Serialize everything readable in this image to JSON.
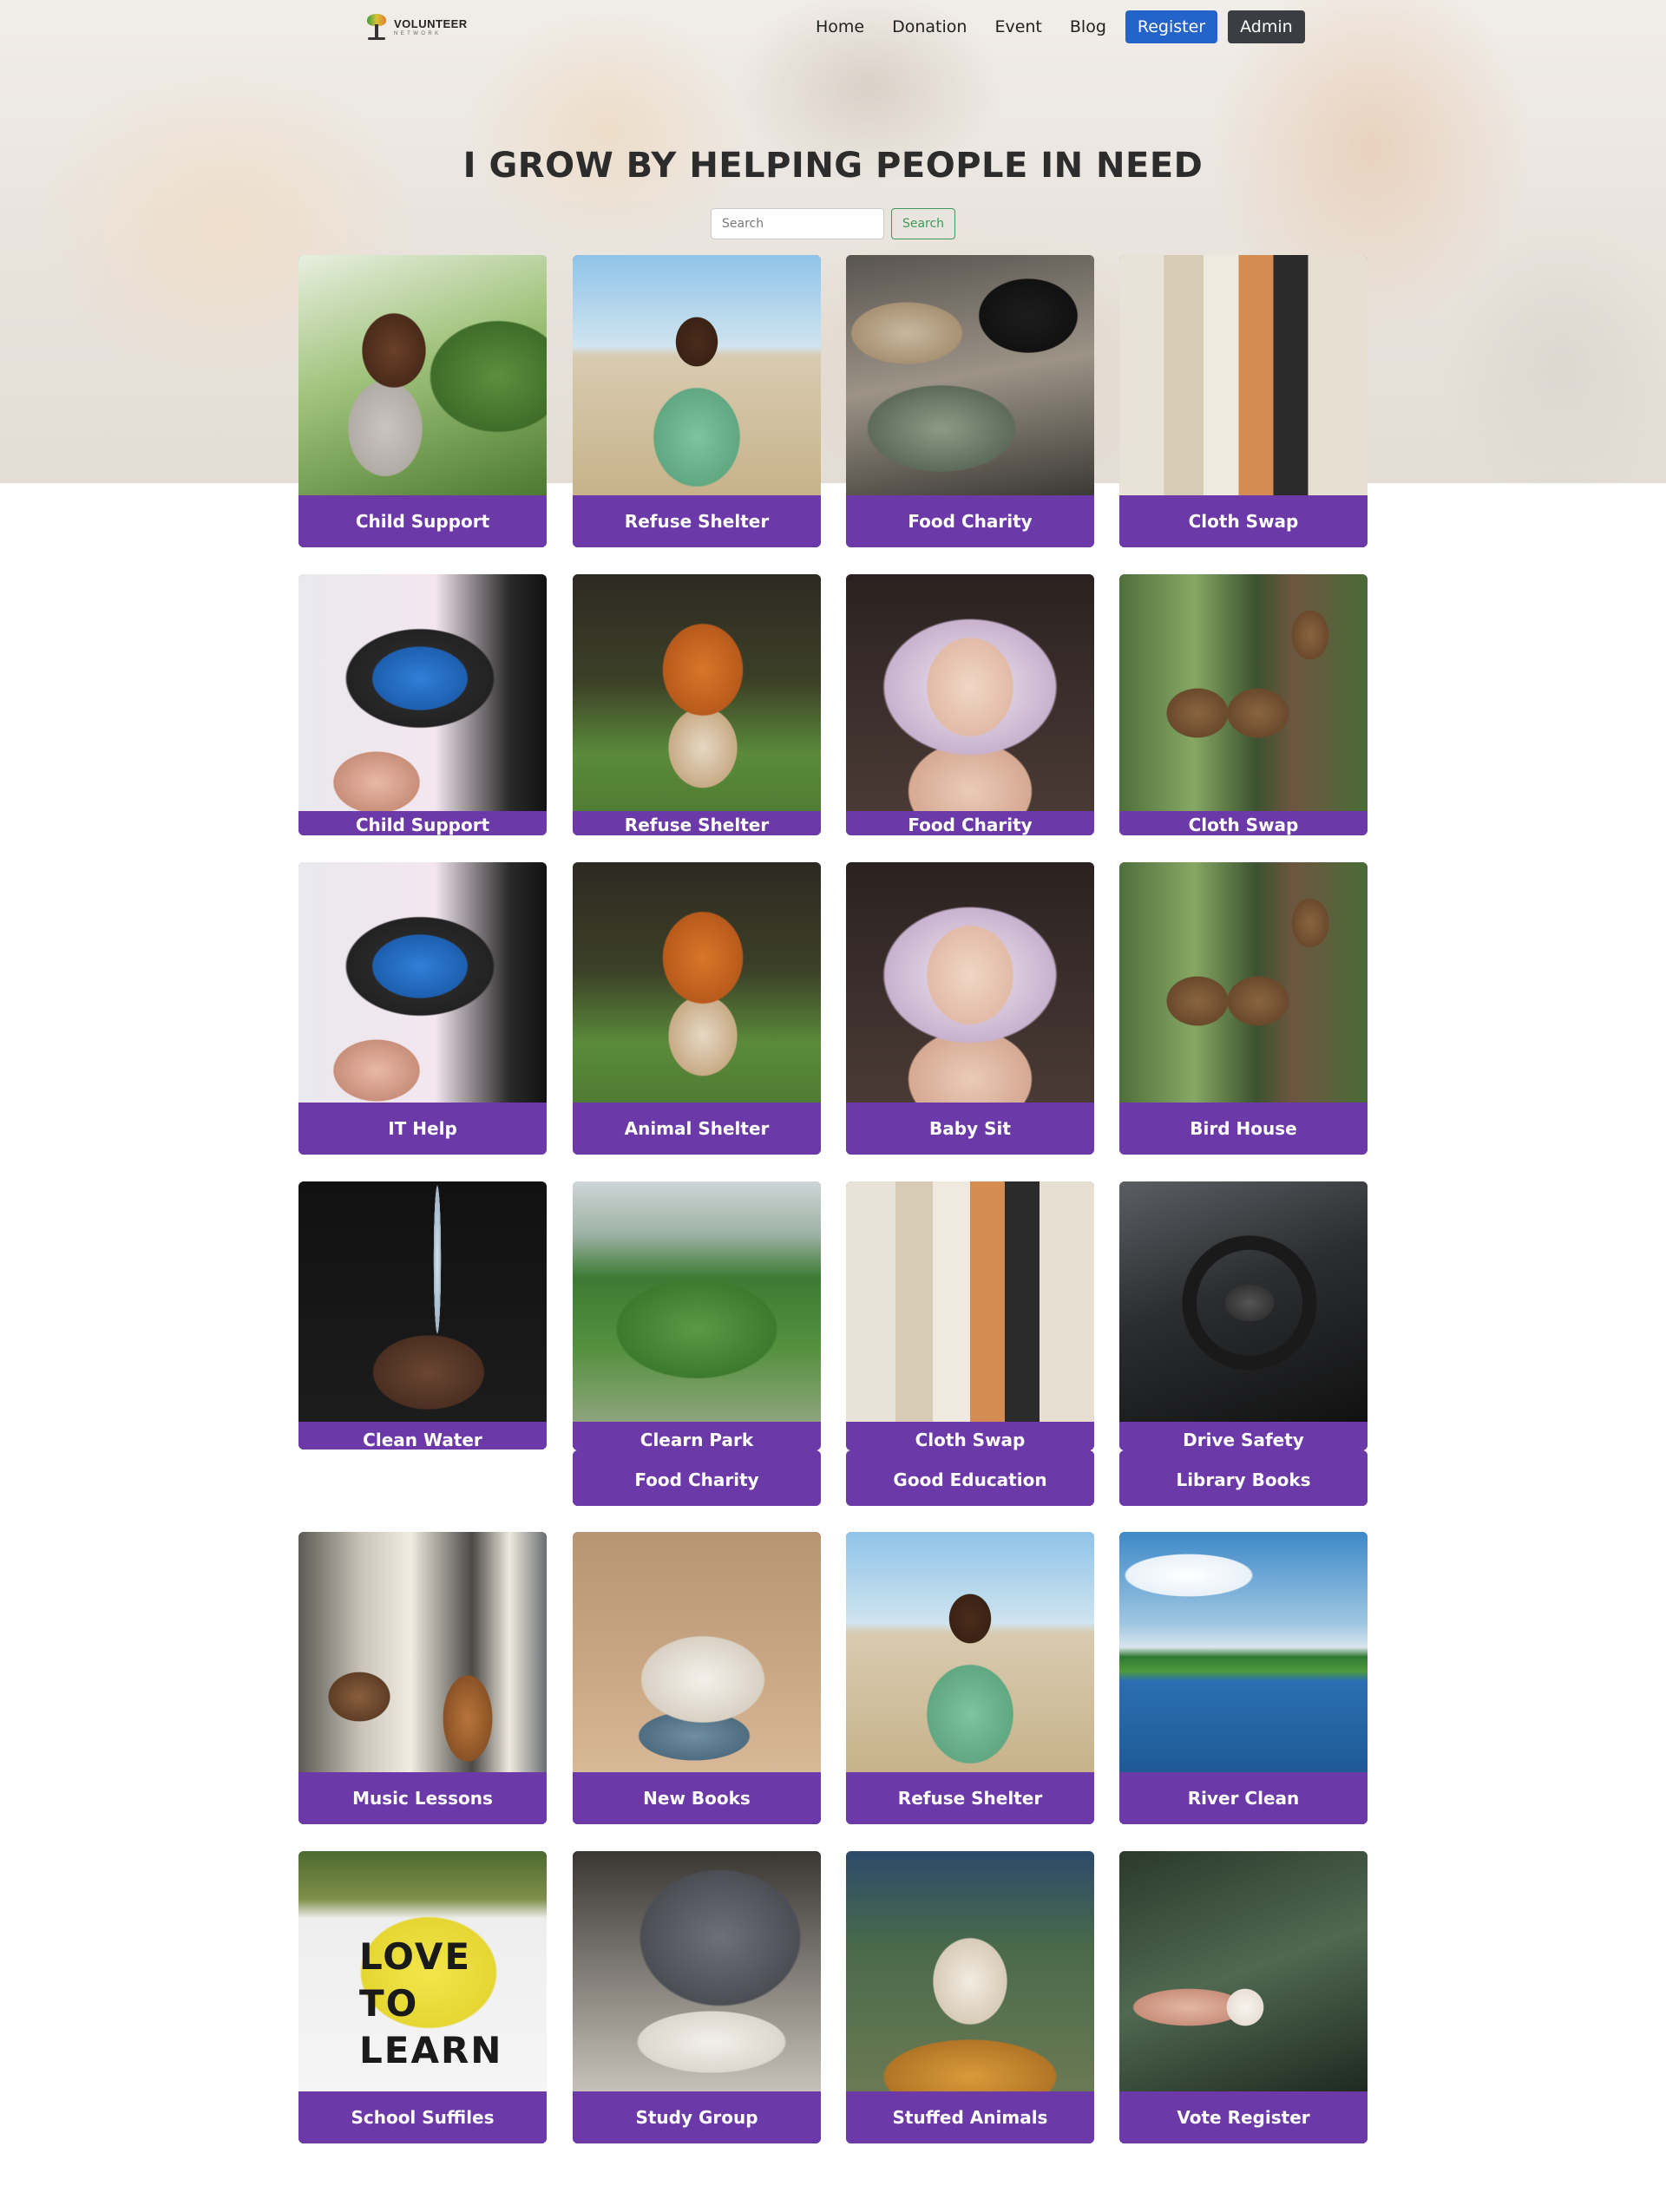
{
  "logo": {
    "name": "VOLUNTEER",
    "tagline": "NETWORK"
  },
  "nav": {
    "items": [
      "Home",
      "Donation",
      "Event",
      "Blog"
    ],
    "register_label": "Register",
    "admin_label": "Admin"
  },
  "hero": {
    "headline": "I GROW BY HELPING PEOPLE IN NEED"
  },
  "search": {
    "placeholder": "Search",
    "button_label": "Search"
  },
  "cards": [
    {
      "label": "Child Support",
      "image": "girl-photo"
    },
    {
      "label": "Refuse Shelter",
      "image": "boy-photo"
    },
    {
      "label": "Food Charity",
      "image": "food-photo"
    },
    {
      "label": "Cloth Swap",
      "image": "clothes-photo"
    },
    {
      "label": "Child Support",
      "image": "laptop-photo"
    },
    {
      "label": "Refuse Shelter",
      "image": "fox-photo"
    },
    {
      "label": "Food Charity",
      "image": "baby-photo"
    },
    {
      "label": "Cloth Swap",
      "image": "birdhouse-photo"
    },
    {
      "label": "IT Help",
      "image": "laptop-photo"
    },
    {
      "label": "Animal Shelter",
      "image": "fox-photo"
    },
    {
      "label": "Baby Sit",
      "image": "baby-photo"
    },
    {
      "label": "Bird House",
      "image": "birdhouse-photo"
    },
    {
      "label": "Clean Water",
      "image": "water-photo"
    },
    {
      "label": "Clearn Park",
      "image": "park-photo"
    },
    {
      "label": "Cloth Swap",
      "image": "clothes-photo"
    },
    {
      "label": "Drive Safety",
      "image": "steering-wheel-photo"
    },
    {
      "label": "Food Charity",
      "image": ""
    },
    {
      "label": "Good Education",
      "image": ""
    },
    {
      "label": "Library Books",
      "image": ""
    },
    {
      "label": "Music Lessons",
      "image": "music-room-photo"
    },
    {
      "label": "New Books",
      "image": "books-photo"
    },
    {
      "label": "Refuse Shelter",
      "image": "boy-photo"
    },
    {
      "label": "River Clean",
      "image": "river-photo"
    },
    {
      "label": "School Suffiles",
      "image": "love-to-learn-sign-photo"
    },
    {
      "label": "Study Group",
      "image": "study-photo"
    },
    {
      "label": "Stuffed Animals",
      "image": "dog-photo"
    },
    {
      "label": "Vote Register",
      "image": "voted-sticker-photo"
    }
  ],
  "sign_text": "LOVE TO LEARN"
}
